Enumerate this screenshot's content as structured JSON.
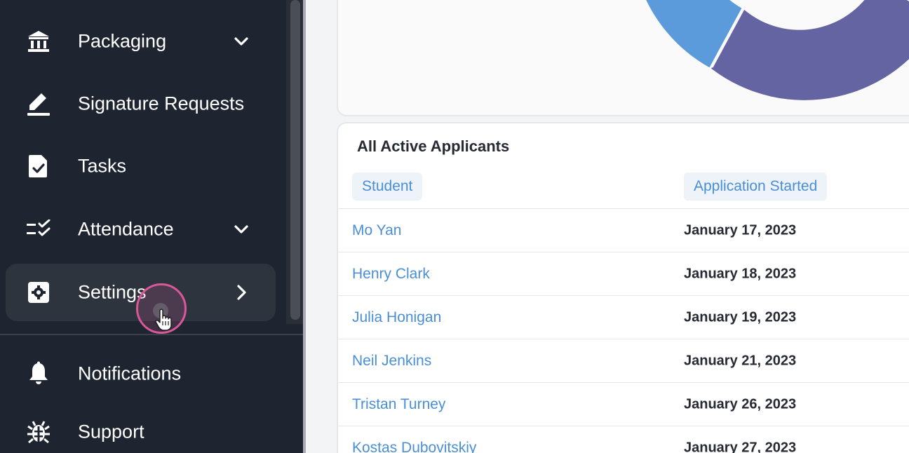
{
  "sidebar": {
    "items": [
      {
        "label": "Packaging",
        "icon": "bank-icon",
        "chevron": "down"
      },
      {
        "label": "Signature Requests",
        "icon": "pen-icon",
        "chevron": ""
      },
      {
        "label": "Tasks",
        "icon": "file-check-icon",
        "chevron": ""
      },
      {
        "label": "Attendance",
        "icon": "checklist-icon",
        "chevron": "down"
      },
      {
        "label": "Settings",
        "icon": "gear-icon",
        "chevron": "right",
        "active": true
      },
      {
        "label": "Notifications",
        "icon": "bell-icon",
        "chevron": ""
      },
      {
        "label": "Support",
        "icon": "bug-icon",
        "chevron": ""
      }
    ]
  },
  "chart": {
    "colors": {
      "segment_light": "#5b9bdc",
      "segment_dark": "#6464a3"
    }
  },
  "table": {
    "title": "All Active Applicants",
    "columns": [
      "Student",
      "Application Started"
    ],
    "rows": [
      {
        "student": "Mo Yan",
        "started": "January 17, 2023"
      },
      {
        "student": "Henry Clark",
        "started": "January 18, 2023"
      },
      {
        "student": "Julia Honigan",
        "started": "January 19, 2023"
      },
      {
        "student": "Neil Jenkins",
        "started": "January 21, 2023"
      },
      {
        "student": "Tristan Turney",
        "started": "January 26, 2023"
      },
      {
        "student": "Kostas Dubovitskiy",
        "started": "January 27, 2023"
      }
    ]
  },
  "colors": {
    "sidebar_bg": "#1f2530",
    "link": "#4a8fd6",
    "cursor_ring": "#d8589a"
  }
}
